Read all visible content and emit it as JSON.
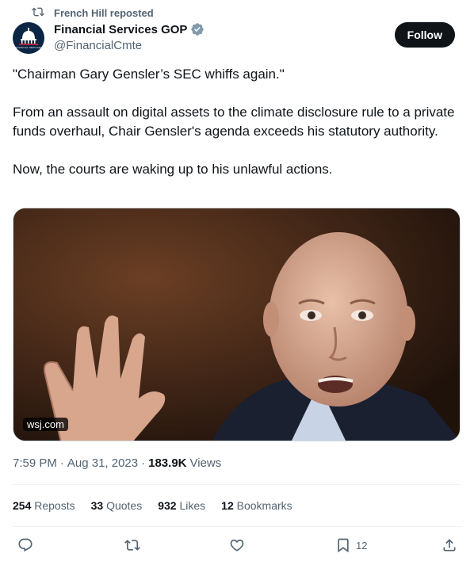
{
  "repost": {
    "label": "French Hill reposted",
    "icon": "repost-icon"
  },
  "author": {
    "name": "Financial Services GOP",
    "handle": "@FinancialCmte",
    "verified_icon": "verified-badge-icon",
    "avatar_caption": "FINANCIAL SERVICES"
  },
  "follow_label": "Follow",
  "tweet": {
    "line1": "\"Chairman Gary Gensler’s SEC whiffs again.\"",
    "line2": "From an assault on digital assets to the climate disclosure rule to a private funds overhaul, Chair Gensler's agenda exceeds his statutory authority.",
    "line3": "Now, the courts are waking up to his unlawful actions."
  },
  "media": {
    "source": "wsj.com"
  },
  "meta": {
    "time": "7:59 PM",
    "date": "Aug 31, 2023",
    "views_count": "183.9K",
    "views_label": "Views",
    "sep": "·"
  },
  "stats": {
    "reposts_count": "254",
    "reposts_label": "Reposts",
    "quotes_count": "33",
    "quotes_label": "Quotes",
    "likes_count": "932",
    "likes_label": "Likes",
    "bookmarks_count": "12",
    "bookmarks_label": "Bookmarks"
  },
  "actions": {
    "bookmark_count": "12"
  },
  "colors": {
    "text": "#0f1419",
    "secondary": "#536471",
    "verified": "#829aab",
    "follow_bg": "#0f1419"
  }
}
